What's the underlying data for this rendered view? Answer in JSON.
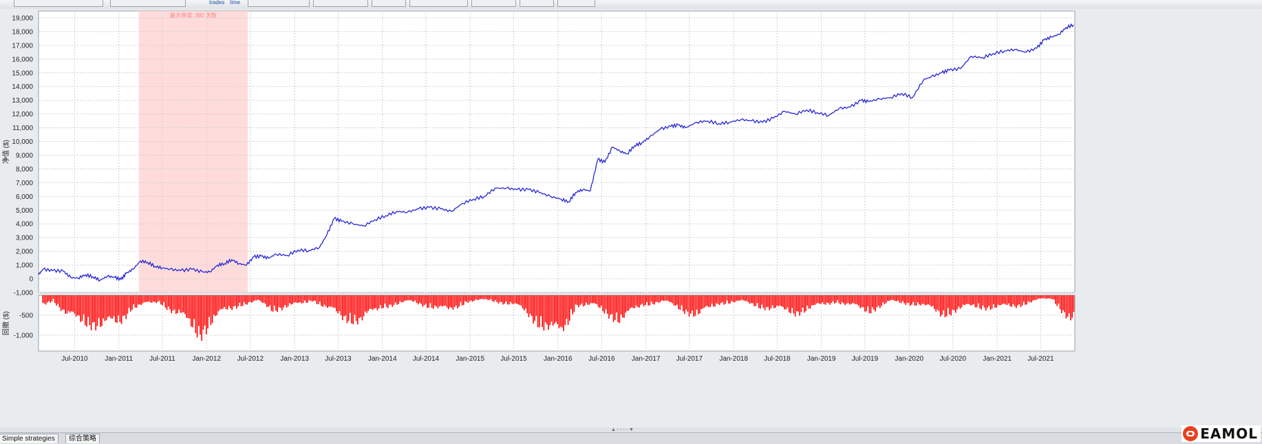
{
  "toolbar": {
    "trades_label": "trades",
    "time_label": "time"
  },
  "colors": {
    "equity_line": "#2424d6",
    "drawdown_bar": "#ff0000",
    "highlight": "#ffd6d6",
    "grid": "#cfcfcf"
  },
  "chart_data": [
    {
      "type": "line",
      "ylabel": "净值 ($)",
      "annotation": {
        "text_prefix": "最大停滞: ",
        "value": "380",
        "text_suffix": " 天数",
        "x_start": "2011-03-25",
        "x_end": "2012-06-20"
      },
      "ylim": [
        -1000,
        19500
      ],
      "yticks": [
        -1000,
        0,
        1000,
        2000,
        3000,
        4000,
        5000,
        6000,
        7000,
        8000,
        9000,
        10000,
        11000,
        12000,
        13000,
        14000,
        15000,
        16000,
        17000,
        18000,
        19000
      ],
      "ytick_labels": [
        "-1,000",
        "0",
        "1,000",
        "2,000",
        "3,000",
        "4,000",
        "5,000",
        "6,000",
        "7,000",
        "8,000",
        "9,000",
        "10,000",
        "11,000",
        "12,000",
        "13,000",
        "14,000",
        "15,000",
        "16,000",
        "17,000",
        "18,000",
        "19,000"
      ],
      "xlim": [
        "2010-02-01",
        "2021-11-20"
      ],
      "grid": true,
      "x": [
        "2010-02-01",
        "2010-02-20",
        "2010-04-01",
        "2010-05-15",
        "2010-06-15",
        "2010-07-15",
        "2010-08-15",
        "2010-09-15",
        "2010-10-15",
        "2010-11-15",
        "2010-12-15",
        "2011-01-10",
        "2011-02-01",
        "2011-03-01",
        "2011-04-01",
        "2011-05-01",
        "2011-06-01",
        "2011-07-01",
        "2011-08-01",
        "2011-09-15",
        "2011-11-01",
        "2011-12-15",
        "2012-01-15",
        "2012-02-15",
        "2012-03-15",
        "2012-04-15",
        "2012-05-15",
        "2012-06-15",
        "2012-07-15",
        "2012-08-15",
        "2012-09-15",
        "2012-10-15",
        "2012-12-01",
        "2013-01-15",
        "2013-03-01",
        "2013-04-15",
        "2013-05-15",
        "2013-06-15",
        "2013-07-15",
        "2013-09-01",
        "2013-10-15",
        "2013-12-01",
        "2014-01-15",
        "2014-03-01",
        "2014-04-15",
        "2014-06-01",
        "2014-07-15",
        "2014-09-01",
        "2014-10-15",
        "2014-12-01",
        "2015-01-15",
        "2015-03-01",
        "2015-04-15",
        "2015-06-01",
        "2015-07-15",
        "2015-09-01",
        "2015-10-15",
        "2015-12-01",
        "2016-01-15",
        "2016-02-15",
        "2016-03-15",
        "2016-04-15",
        "2016-05-15",
        "2016-06-15",
        "2016-07-15",
        "2016-08-15",
        "2016-09-15",
        "2016-10-15",
        "2016-11-15",
        "2016-12-15",
        "2017-01-15",
        "2017-03-01",
        "2017-04-15",
        "2017-05-15",
        "2017-06-15",
        "2017-08-01",
        "2017-09-15",
        "2017-11-01",
        "2017-12-15",
        "2018-02-01",
        "2018-03-15",
        "2018-05-01",
        "2018-06-15",
        "2018-08-01",
        "2018-09-15",
        "2018-11-01",
        "2018-12-15",
        "2019-02-01",
        "2019-03-15",
        "2019-05-01",
        "2019-06-15",
        "2019-07-15",
        "2019-09-01",
        "2019-10-15",
        "2019-12-01",
        "2020-01-15",
        "2020-03-01",
        "2020-04-01",
        "2020-05-15",
        "2020-06-15",
        "2020-08-01",
        "2020-09-15",
        "2020-11-01",
        "2020-12-15",
        "2021-02-01",
        "2021-03-15",
        "2021-05-01",
        "2021-06-15",
        "2021-07-15",
        "2021-08-15",
        "2021-09-15",
        "2021-10-15",
        "2021-11-15"
      ],
      "y": [
        300,
        700,
        600,
        550,
        100,
        50,
        300,
        150,
        -100,
        200,
        100,
        -50,
        400,
        700,
        1300,
        1200,
        900,
        800,
        700,
        600,
        700,
        500,
        500,
        1000,
        1100,
        1400,
        1100,
        1000,
        1600,
        1650,
        1500,
        1800,
        1700,
        2100,
        2050,
        2300,
        3200,
        4400,
        4200,
        4000,
        3850,
        4300,
        4600,
        4900,
        4850,
        5100,
        5200,
        5100,
        4900,
        5500,
        5800,
        6000,
        6600,
        6600,
        6500,
        6500,
        6300,
        6000,
        5800,
        5600,
        6300,
        6500,
        6400,
        8700,
        8500,
        9600,
        9300,
        9100,
        9700,
        9900,
        10300,
        10900,
        11100,
        11200,
        11000,
        11400,
        11500,
        11300,
        11400,
        11600,
        11500,
        11400,
        11700,
        12200,
        12000,
        12300,
        12100,
        11900,
        12400,
        12500,
        13000,
        12900,
        13100,
        13200,
        13500,
        13200,
        14500,
        14700,
        15000,
        15200,
        15300,
        16200,
        16100,
        16400,
        16600,
        16700,
        16500,
        16800,
        17400,
        17600,
        17800,
        18300,
        18500,
        18300,
        17700
      ]
    },
    {
      "type": "bar",
      "ylabel": "回撤 ($)",
      "ylim": [
        -1400,
        0
      ],
      "yticks": [
        -1000,
        -500
      ],
      "ytick_labels": [
        "-1,000",
        "-500"
      ],
      "xticks": [
        "2010-07-01",
        "2011-01-01",
        "2011-07-01",
        "2012-01-01",
        "2012-07-01",
        "2013-01-01",
        "2013-07-01",
        "2014-01-01",
        "2014-07-01",
        "2015-01-01",
        "2015-07-01",
        "2016-01-01",
        "2016-07-01",
        "2017-01-01",
        "2017-07-01",
        "2018-01-01",
        "2018-07-01",
        "2019-01-01",
        "2019-07-01",
        "2020-01-01",
        "2020-07-01",
        "2021-01-01",
        "2021-07-01"
      ],
      "xtick_labels": [
        "Jul-2010",
        "Jan-2011",
        "Jul-2011",
        "Jan-2012",
        "Jul-2012",
        "Jan-2013",
        "Jul-2013",
        "Jan-2014",
        "Jul-2014",
        "Jan-2015",
        "Jul-2015",
        "Jan-2016",
        "Jul-2016",
        "Jan-2017",
        "Jul-2017",
        "Jan-2018",
        "Jul-2018",
        "Jan-2019",
        "Jul-2019",
        "Jan-2020",
        "Jul-2020",
        "Jan-2021",
        "Jul-2021"
      ],
      "drawdown_valleys": [
        {
          "x": "2010-02-15",
          "y": -300
        },
        {
          "x": "2010-04-01",
          "y": -150
        },
        {
          "x": "2010-06-01",
          "y": -700
        },
        {
          "x": "2010-08-01",
          "y": -800
        },
        {
          "x": "2010-10-25",
          "y": -1000
        },
        {
          "x": "2011-01-01",
          "y": -850
        },
        {
          "x": "2011-02-20",
          "y": -400
        },
        {
          "x": "2011-06-15",
          "y": -200
        },
        {
          "x": "2011-09-15",
          "y": -700
        },
        {
          "x": "2011-12-01",
          "y": -1200
        },
        {
          "x": "2012-03-15",
          "y": -500
        },
        {
          "x": "2012-05-15",
          "y": -300
        },
        {
          "x": "2012-08-01",
          "y": -200
        },
        {
          "x": "2012-10-01",
          "y": -450
        },
        {
          "x": "2013-01-15",
          "y": -300
        },
        {
          "x": "2013-03-15",
          "y": -150
        },
        {
          "x": "2013-07-15",
          "y": -700
        },
        {
          "x": "2013-10-01",
          "y": -800
        },
        {
          "x": "2014-01-01",
          "y": -350
        },
        {
          "x": "2014-05-01",
          "y": -200
        },
        {
          "x": "2014-10-01",
          "y": -500
        },
        {
          "x": "2014-12-15",
          "y": -200
        },
        {
          "x": "2015-03-15",
          "y": -150
        },
        {
          "x": "2015-07-01",
          "y": -300
        },
        {
          "x": "2015-10-01",
          "y": -800
        },
        {
          "x": "2016-01-10",
          "y": -1300
        },
        {
          "x": "2016-03-15",
          "y": -300
        },
        {
          "x": "2016-06-01",
          "y": -350
        },
        {
          "x": "2016-09-15",
          "y": -800
        },
        {
          "x": "2016-12-15",
          "y": -300
        },
        {
          "x": "2017-03-15",
          "y": -200
        },
        {
          "x": "2017-08-01",
          "y": -650
        },
        {
          "x": "2017-11-01",
          "y": -250
        },
        {
          "x": "2018-02-01",
          "y": -200
        },
        {
          "x": "2018-05-15",
          "y": -400
        },
        {
          "x": "2018-09-15",
          "y": -550
        },
        {
          "x": "2018-12-15",
          "y": -350
        },
        {
          "x": "2019-03-01",
          "y": -200
        },
        {
          "x": "2019-07-15",
          "y": -500
        },
        {
          "x": "2019-10-15",
          "y": -200
        },
        {
          "x": "2020-02-15",
          "y": -300
        },
        {
          "x": "2020-05-15",
          "y": -600
        },
        {
          "x": "2020-09-15",
          "y": -350
        },
        {
          "x": "2020-12-15",
          "y": -400
        },
        {
          "x": "2021-03-15",
          "y": -350
        },
        {
          "x": "2021-06-15",
          "y": -150
        },
        {
          "x": "2021-08-15",
          "y": -100
        },
        {
          "x": "2021-11-01",
          "y": -800
        },
        {
          "x": "2021-11-20",
          "y": -700
        }
      ]
    }
  ],
  "bottom_tabs": [
    "Simple strategies",
    "综合策略"
  ],
  "splitter": "▲ - - - - ▼",
  "logo": {
    "text": "EAMOL"
  }
}
